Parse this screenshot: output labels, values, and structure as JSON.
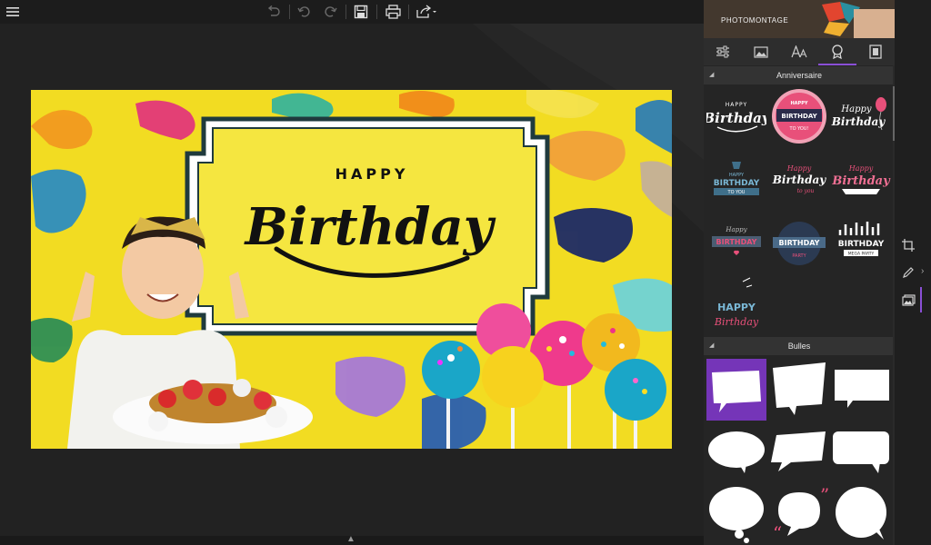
{
  "toolbar": {
    "menu_icon": "hamburger-icon",
    "buttons": [
      {
        "name": "revert",
        "icon": "revert-icon",
        "enabled": false
      },
      {
        "name": "undo",
        "icon": "undo-icon",
        "enabled": false
      },
      {
        "name": "redo",
        "icon": "redo-icon",
        "enabled": false
      },
      {
        "name": "save",
        "icon": "save-icon",
        "enabled": true
      },
      {
        "name": "print",
        "icon": "print-icon",
        "enabled": true
      },
      {
        "name": "share",
        "icon": "share-icon",
        "enabled": true
      }
    ]
  },
  "canvas": {
    "happy_text": "HAPPY",
    "birthday_text": "Birthday",
    "background_color": "#f2dc22",
    "frame_fill": "#f5e640",
    "frame_stroke": "#1f3a3d"
  },
  "panel": {
    "banner_title": "PHOTOMONTAGE",
    "tabs": [
      {
        "name": "adjustments",
        "icon": "sliders-icon"
      },
      {
        "name": "image",
        "icon": "image-icon"
      },
      {
        "name": "text",
        "icon": "text-size-icon"
      },
      {
        "name": "stickers",
        "icon": "ribbon-badge-icon",
        "active": true
      },
      {
        "name": "frames",
        "icon": "frame-icon"
      }
    ],
    "sections": [
      {
        "title": "Anniversaire",
        "stickers": [
          {
            "line1": "HAPPY",
            "line2": "Birthday"
          },
          {
            "line1": "HAPPY",
            "line2": "BIRTHDAY",
            "line3": "TO YOU!"
          },
          {
            "line1": "Happy",
            "line2": "Birthday"
          },
          {
            "line1": "HAPPY",
            "line2": "BIRTHDAY",
            "line3": "TO YOU"
          },
          {
            "line1": "Happy",
            "line2": "Birthday",
            "line3": "to you"
          },
          {
            "line1": "Happy",
            "line2": "Birthday"
          },
          {
            "line1": "Happy",
            "line2": "BIRTHDAY"
          },
          {
            "line1": "BIRTHDAY",
            "line2": "PARTY"
          },
          {
            "line1": "BIRTHDAY",
            "line2": "MEGA PARTY"
          },
          {
            "line1": "HAPPY",
            "line2": "Birthday"
          }
        ]
      },
      {
        "title": "Bulles",
        "stickers": [
          {
            "shape": "square-bubble",
            "selected": true
          },
          {
            "shape": "slanted-bubble"
          },
          {
            "shape": "rect-bubble"
          },
          {
            "shape": "oval-bubble"
          },
          {
            "shape": "wide-slanted-bubble"
          },
          {
            "shape": "rounded-rect-bubble"
          },
          {
            "shape": "thought-bubble"
          },
          {
            "shape": "quote-bubble"
          },
          {
            "shape": "round-bubble"
          }
        ]
      }
    ]
  },
  "rail": {
    "items": [
      {
        "name": "crop",
        "icon": "crop-icon"
      },
      {
        "name": "draw",
        "icon": "pencil-icon"
      },
      {
        "name": "insert-image",
        "icon": "insert-image-icon",
        "active": true
      }
    ]
  }
}
